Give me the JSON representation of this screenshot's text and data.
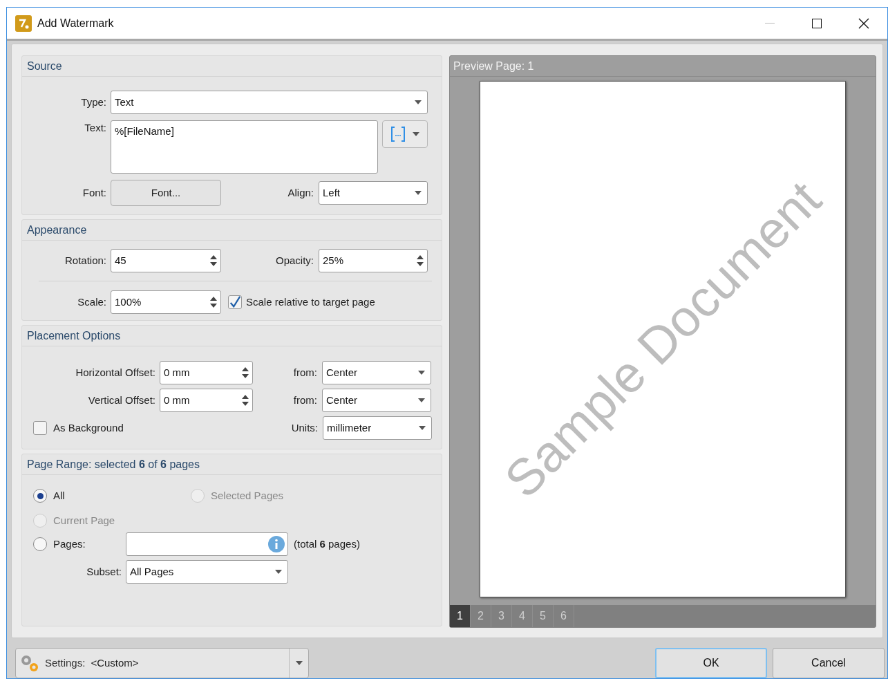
{
  "window": {
    "title": "Add Watermark"
  },
  "source": {
    "title": "Source",
    "type": {
      "label": "Type:",
      "value": "Text"
    },
    "text": {
      "label": "Text:",
      "value": "%[FileName]"
    },
    "font": {
      "label": "Font:",
      "button": "Font..."
    },
    "align": {
      "label": "Align:",
      "value": "Left"
    }
  },
  "appearance": {
    "title": "Appearance",
    "rotation": {
      "label": "Rotation:",
      "value": "45"
    },
    "opacity": {
      "label": "Opacity:",
      "value": "25%"
    },
    "scale": {
      "label": "Scale:",
      "value": "100%"
    },
    "scale_relative": {
      "label": "Scale relative to target page",
      "checked": true
    }
  },
  "placement": {
    "title": "Placement Options",
    "horizontal_offset": {
      "label": "Horizontal Offset:",
      "value": "0 mm",
      "from_label": "from:",
      "from_value": "Center"
    },
    "vertical_offset": {
      "label": "Vertical Offset:",
      "value": "0 mm",
      "from_label": "from:",
      "from_value": "Center"
    },
    "as_background": {
      "label": "As Background",
      "checked": false
    },
    "units": {
      "label": "Units:",
      "value": "millimeter"
    }
  },
  "page_range": {
    "title": "Page Range: selected **6** of **6** pages",
    "options": [
      {
        "label": "All",
        "selected": true,
        "disabled": false
      },
      {
        "label": "Selected Pages",
        "selected": false,
        "disabled": true
      },
      {
        "label": "Current Page",
        "selected": false,
        "disabled": true
      },
      {
        "label": "Pages:",
        "selected": false,
        "disabled": false
      }
    ],
    "total": "(total **6** pages)",
    "subset": {
      "label": "Subset:",
      "value": "All Pages"
    }
  },
  "preview": {
    "title": "Preview Page: 1",
    "watermark": "Sample Document",
    "pages": [
      {
        "label": "1",
        "selected": true
      },
      {
        "label": "2",
        "selected": false
      },
      {
        "label": "3",
        "selected": false
      },
      {
        "label": "4",
        "selected": false
      },
      {
        "label": "5",
        "selected": false
      },
      {
        "label": "6",
        "selected": false
      }
    ]
  },
  "footer": {
    "settings": {
      "label": "Settings:",
      "value": "<Custom>"
    },
    "buttons": [
      "OK",
      "Cancel"
    ]
  }
}
